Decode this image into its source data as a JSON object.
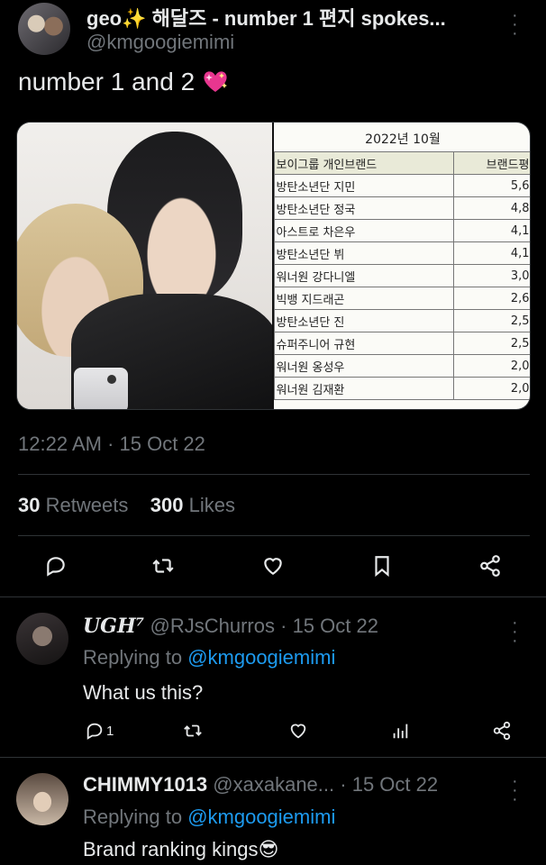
{
  "tweet": {
    "display_name": "geo✨ 해달즈 - number 1 편지 spokes...",
    "handle": "@kmgoogiemimi",
    "text": "number 1 and 2",
    "emoji": "sparkling-heart",
    "timestamp": "12:22 AM · 15 Oct 22",
    "retweets_count": "30",
    "retweets_label": "Retweets",
    "likes_count": "300",
    "likes_label": "Likes"
  },
  "table_image": {
    "title": "2022년 10월",
    "headers": [
      "보이그룹 개인브랜드",
      "브랜드평"
    ],
    "rows": [
      [
        "방탄소년단 지민",
        "5,6"
      ],
      [
        "방탄소년단 정국",
        "4,8"
      ],
      [
        "아스트로 차은우",
        "4,1"
      ],
      [
        "방탄소년단 뷔",
        "4,1"
      ],
      [
        "워너원 강다니엘",
        "3,0"
      ],
      [
        "빅뱅 지드래곤",
        "2,6"
      ],
      [
        "방탄소년단 진",
        "2,5"
      ],
      [
        "슈퍼주니어 규현",
        "2,5"
      ],
      [
        "워너원 옹성우",
        "2,0"
      ],
      [
        "워너원 김재환",
        "2,0"
      ]
    ]
  },
  "replies": [
    {
      "name": "UGH⁷",
      "handle": "@RJsChurros",
      "date": "· 15 Oct 22",
      "replying_prefix": "Replying to ",
      "replying_mention": "@kmgoogiemimi",
      "text": "What us this?",
      "reply_count": "1"
    },
    {
      "name": "CHIMMY1013",
      "handle": "@xaxakane...",
      "date": "· 15 Oct 22",
      "replying_prefix": "Replying to ",
      "replying_mention": "@kmgoogiemimi",
      "text": "Brand ranking kings😎"
    }
  ],
  "colors": {
    "background": "#000000",
    "text": "#e7e9ea",
    "secondary": "#71767b",
    "link": "#1d9bf0",
    "divider": "#2f3336"
  }
}
